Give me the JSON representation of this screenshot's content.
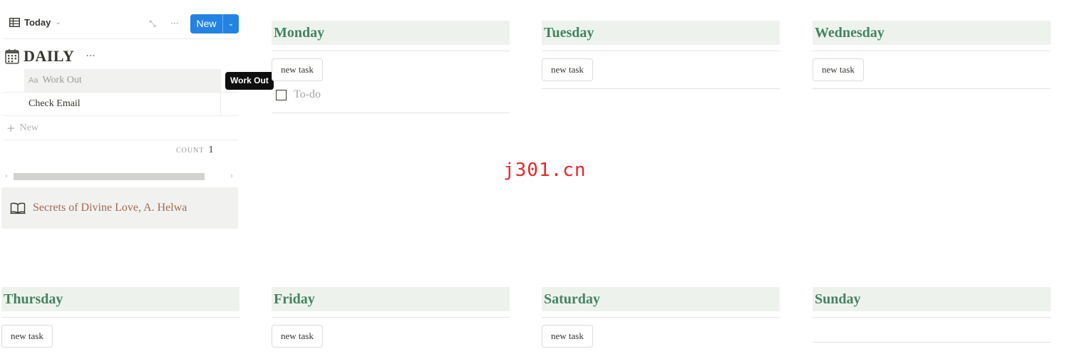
{
  "toolbar": {
    "view_label": "Today",
    "new_label": "New"
  },
  "database": {
    "title": "DAILY",
    "rows": [
      {
        "name": "Work Out"
      },
      {
        "name": "Check Email"
      }
    ],
    "add_row_label": "New",
    "count_label": "COUNT",
    "count_value": "1"
  },
  "tooltip": "Work Out",
  "callout": {
    "text": "Secrets of Divine Love, A. Helwa"
  },
  "days": [
    {
      "name": "Monday",
      "button": "new task",
      "todo": "To-do"
    },
    {
      "name": "Tuesday",
      "button": "new task"
    },
    {
      "name": "Wednesday",
      "button": "new task"
    },
    {
      "name": "Thursday",
      "button": "new task"
    },
    {
      "name": "Friday",
      "button": "new task"
    },
    {
      "name": "Saturday",
      "button": "new task"
    },
    {
      "name": "Sunday"
    }
  ],
  "watermark": "j301.cn",
  "colors": {
    "accent": "#2383e2",
    "day_header_bg": "#edf3ec",
    "day_header_text": "#448361",
    "callout_bg": "#f1f1ef",
    "callout_text": "#9f6b53",
    "watermark": "#e8262a"
  },
  "icons": {
    "view": "table-icon",
    "expand": "expand-icon",
    "more": "more-icon",
    "title": "calendar-icon",
    "callout": "book-icon",
    "property": "text-property-icon",
    "add": "plus-icon"
  }
}
